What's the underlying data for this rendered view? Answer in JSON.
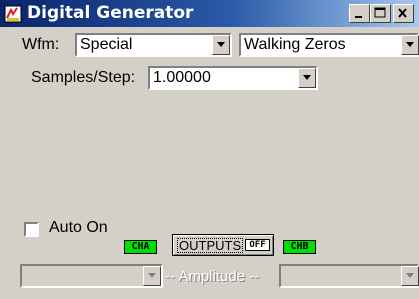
{
  "window": {
    "title": "Digital Generator"
  },
  "waveform": {
    "label": "Wfm:",
    "type_value": "Special",
    "pattern_value": "Walking Zeros"
  },
  "samples": {
    "label": "Samples/Step:",
    "value": "1.00000"
  },
  "auto_on": {
    "label": "Auto On",
    "checked": false
  },
  "channels": {
    "cha": "CHA",
    "chb": "CHB"
  },
  "outputs": {
    "label": "OUTPUTS",
    "state": "OFF"
  },
  "amplitude": {
    "label": "-- Amplitude --"
  },
  "colors": {
    "title_bar": "#0a246a",
    "channel_tag": "#00e000",
    "face": "#d4d0c8"
  }
}
